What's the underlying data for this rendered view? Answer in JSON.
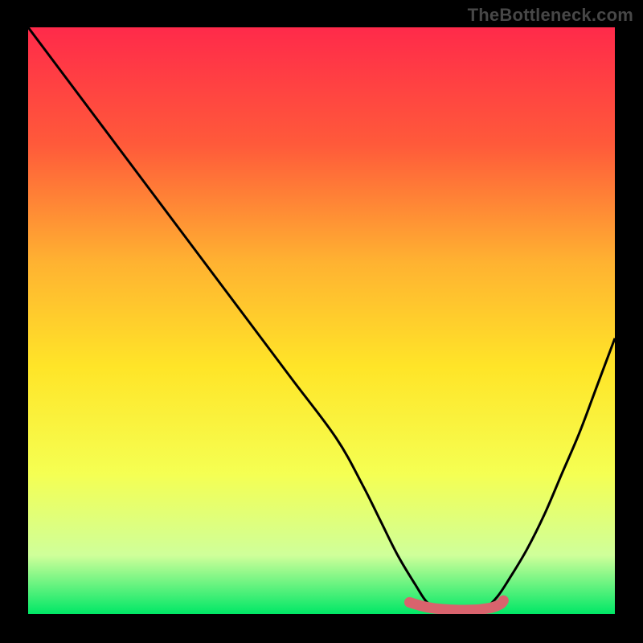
{
  "watermark": "TheBottleneck.com",
  "chart_data": {
    "type": "line",
    "xlim": [
      0,
      100
    ],
    "ylim": [
      0,
      100
    ],
    "title": "",
    "xlabel": "",
    "ylabel": "",
    "series": [
      {
        "name": "bottleneck-curve",
        "x": [
          0,
          7.5,
          15,
          22.5,
          30,
          37.5,
          45,
          52.5,
          57,
          60,
          63,
          66,
          68,
          70,
          72,
          74,
          76,
          78,
          80,
          82,
          85,
          88,
          91,
          94,
          97,
          100
        ],
        "values": [
          100,
          90,
          80,
          70,
          60,
          50,
          40,
          30,
          22,
          16,
          10,
          5,
          2,
          1,
          0,
          0,
          0,
          1,
          3,
          6,
          11,
          17,
          24,
          31,
          39,
          47
        ]
      },
      {
        "name": "sweet-spot",
        "x": [
          65,
          67,
          69,
          71,
          73,
          75,
          77,
          79,
          80.5,
          81
        ],
        "values": [
          2,
          1.4,
          1,
          0.8,
          0.7,
          0.7,
          0.8,
          1.1,
          1.7,
          2.3
        ]
      }
    ],
    "gradient_stops": [
      {
        "offset": 0,
        "color": "#ff2a4a"
      },
      {
        "offset": 20,
        "color": "#ff5a3a"
      },
      {
        "offset": 40,
        "color": "#ffb231"
      },
      {
        "offset": 58,
        "color": "#ffe528"
      },
      {
        "offset": 76,
        "color": "#f5ff52"
      },
      {
        "offset": 90,
        "color": "#cfff9a"
      },
      {
        "offset": 100,
        "color": "#00e766"
      }
    ],
    "sweet_spot_color": "#d9636d",
    "curve_color": "#000000"
  }
}
